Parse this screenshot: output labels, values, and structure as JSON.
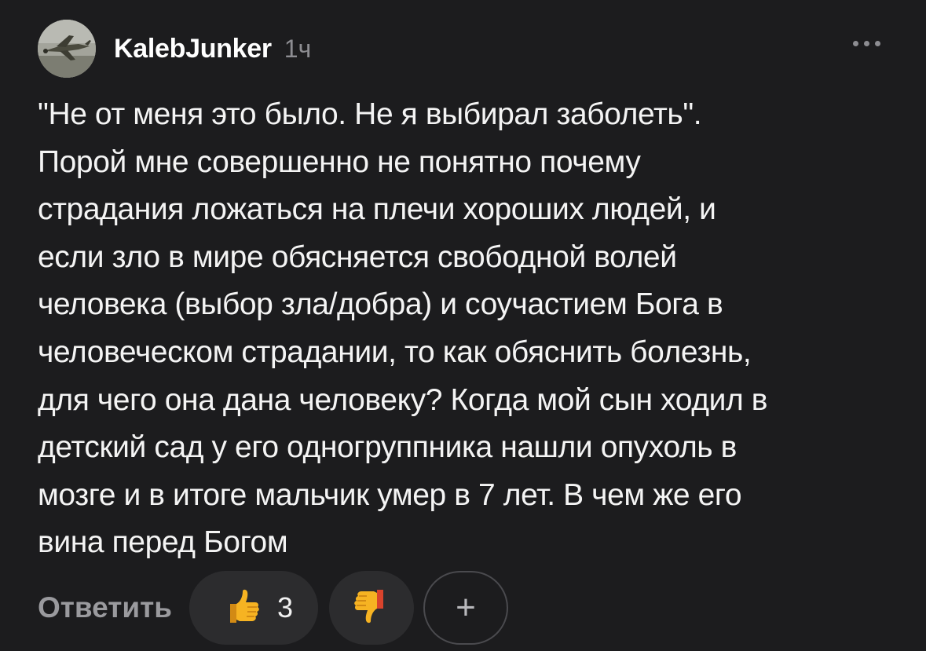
{
  "comment": {
    "author": "KalebJunker",
    "time": "1ч",
    "text": "\"Не от меня это было. Не я выбирал заболеть\".\nПорой мне совершенно не понятно почему\nстрадания ложаться на плечи хороших людей, и\nесли зло в мире обясняется свободной волей\nчеловека (выбор зла/добра) и соучастием Бога в\nчеловеческом страдании, то как обяснить болезнь,\nдля чего она дана человеку? Когда мой сын ходил в\nдетский сад у его одногруппника нашли опухоль в\nмозге и в итоге мальчик умер в 7 лет. В чем же его\nвина перед Богом"
  },
  "actions": {
    "reply_label": "Ответить",
    "like_count": "3",
    "add_symbol": "+"
  },
  "icons": {
    "more": "more-horizontal-icon",
    "like": "thumbs-up-emoji-icon",
    "dislike": "thumbs-down-emoji-icon",
    "add": "plus-icon"
  },
  "colors": {
    "background": "#1c1c1e",
    "pill": "#2c2c2e",
    "muted": "#8d8d92",
    "emoji": "#f6b322"
  }
}
